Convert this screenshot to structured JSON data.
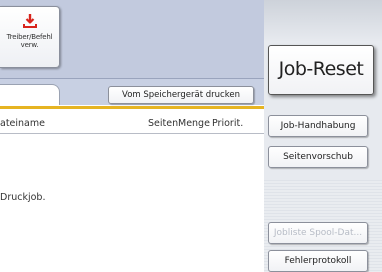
{
  "toolbar": {
    "driver_button_label": "Treiber/Befehl\nverw.",
    "driver_icon": "download-arrow-icon",
    "accent_color": "#d8231c"
  },
  "main": {
    "print_from_storage_label": "Vom Speichergerät drucken",
    "columns": {
      "filename": "ateiname",
      "pages": "Seiten",
      "quantity": "Menge",
      "priority": "Priorit."
    },
    "message": "Druckjob.",
    "highlight_color": "#e6b422"
  },
  "side": {
    "job_reset_label": "Job-Reset",
    "job_handling_label": "Job-Handhabung",
    "page_preview_label": "Seitenvorschub",
    "spool_label": "Jobliste Spool-Dat...",
    "error_log_label": "Fehlerprotokoll"
  }
}
